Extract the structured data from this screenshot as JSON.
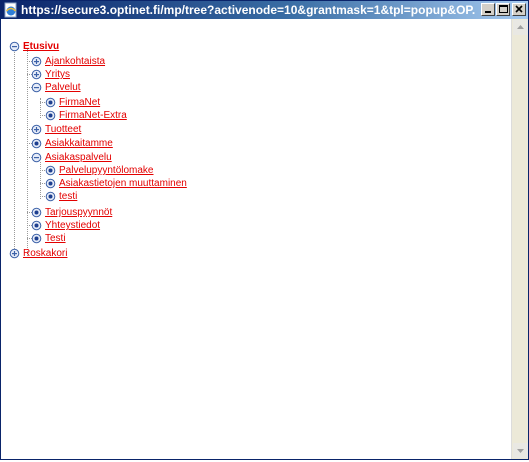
{
  "window": {
    "title": "https://secure3.optinet.fi/mp/tree?activenode=10&grantmask=1&tpl=popup&OP..."
  },
  "tree": {
    "root": {
      "label": "Etusivu",
      "state": "expanded"
    },
    "items": [
      {
        "label": "Ajankohtaista",
        "state": "collapsed",
        "level": 1
      },
      {
        "label": "Yritys",
        "state": "collapsed",
        "level": 1
      },
      {
        "label": "Palvelut",
        "state": "expanded",
        "level": 1
      },
      {
        "label": "FirmaNet",
        "state": "leaf",
        "level": 2
      },
      {
        "label": "FirmaNet-Extra",
        "state": "leaf",
        "level": 2
      },
      {
        "label": "Tuotteet",
        "state": "collapsed",
        "level": 1
      },
      {
        "label": "Asiakkaitamme",
        "state": "leaf",
        "level": 1
      },
      {
        "label": "Asiakaspalvelu",
        "state": "expanded",
        "level": 1
      },
      {
        "label": "Palvelupyyntölomake",
        "state": "leaf",
        "level": 2
      },
      {
        "label": "Asiakastietojen muuttaminen",
        "state": "leaf",
        "level": 2
      },
      {
        "label": "testi",
        "state": "leaf",
        "level": 2
      },
      {
        "label": "Tarjouspyynnöt",
        "state": "leaf",
        "level": 1
      },
      {
        "label": "Yhteystiedot",
        "state": "leaf",
        "level": 1
      },
      {
        "label": "Testi",
        "state": "leaf",
        "level": 1
      }
    ],
    "trash": {
      "label": "Roskakori",
      "state": "collapsed"
    }
  },
  "colors": {
    "link": "#e30000",
    "titlebar_start": "#0a246a",
    "titlebar_end": "#a6caf0"
  }
}
